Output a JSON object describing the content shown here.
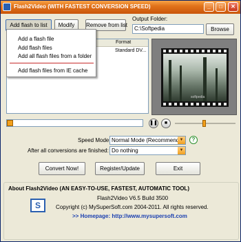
{
  "window": {
    "title": "Flash2Video (WITH FASTEST CONVERSION SPEED)",
    "controls": {
      "minimize": "_",
      "maximize": "□",
      "close": "✕"
    }
  },
  "toolbar": {
    "add_label": "Add flash to list",
    "modify_label": "Modify",
    "remove_label": "Remove from list"
  },
  "output": {
    "label": "Output Folder:",
    "value": "C:\\Softpedia",
    "browse_label": "Browse"
  },
  "add_menu": {
    "items": [
      "Add a flash file",
      "Add flash files",
      "Add all flash files from a folder",
      "Add flash files from IE cache"
    ]
  },
  "file_list": {
    "columns": [
      "Format"
    ],
    "rows": [
      {
        "format": "Standard DV..."
      }
    ]
  },
  "playback": {
    "progress": 0.0,
    "pause_icon": "pause-icon",
    "stop_icon": "stop-icon",
    "volume": 0.48,
    "scene_caption": "softpedia"
  },
  "settings": {
    "speed_label": "Speed Mode:",
    "speed_value": "Normal Mode (Recommend)",
    "after_label": "After all conversions are finished:",
    "after_value": "Do nothing"
  },
  "actions": {
    "convert_label": "Convert Now!",
    "register_label": "Register/Update",
    "exit_label": "Exit"
  },
  "about": {
    "title": "About Flash2Video (AN EASY-TO-USE, FASTEST, AUTOMATIC TOOL)",
    "version": "Flash2Video V6.5 Build 3500",
    "copyright": "Copyright (c) MySuperSoft.com 2004-2011. All rights reserved.",
    "homepage_prefix": ">> Homepage:",
    "homepage_url": "http://www.mysupersoft.com"
  },
  "colors": {
    "title_bar": "#e2731b",
    "accent": "#f2a01c",
    "link": "#1a3fb0",
    "menu_separator": "#c62b2b"
  }
}
